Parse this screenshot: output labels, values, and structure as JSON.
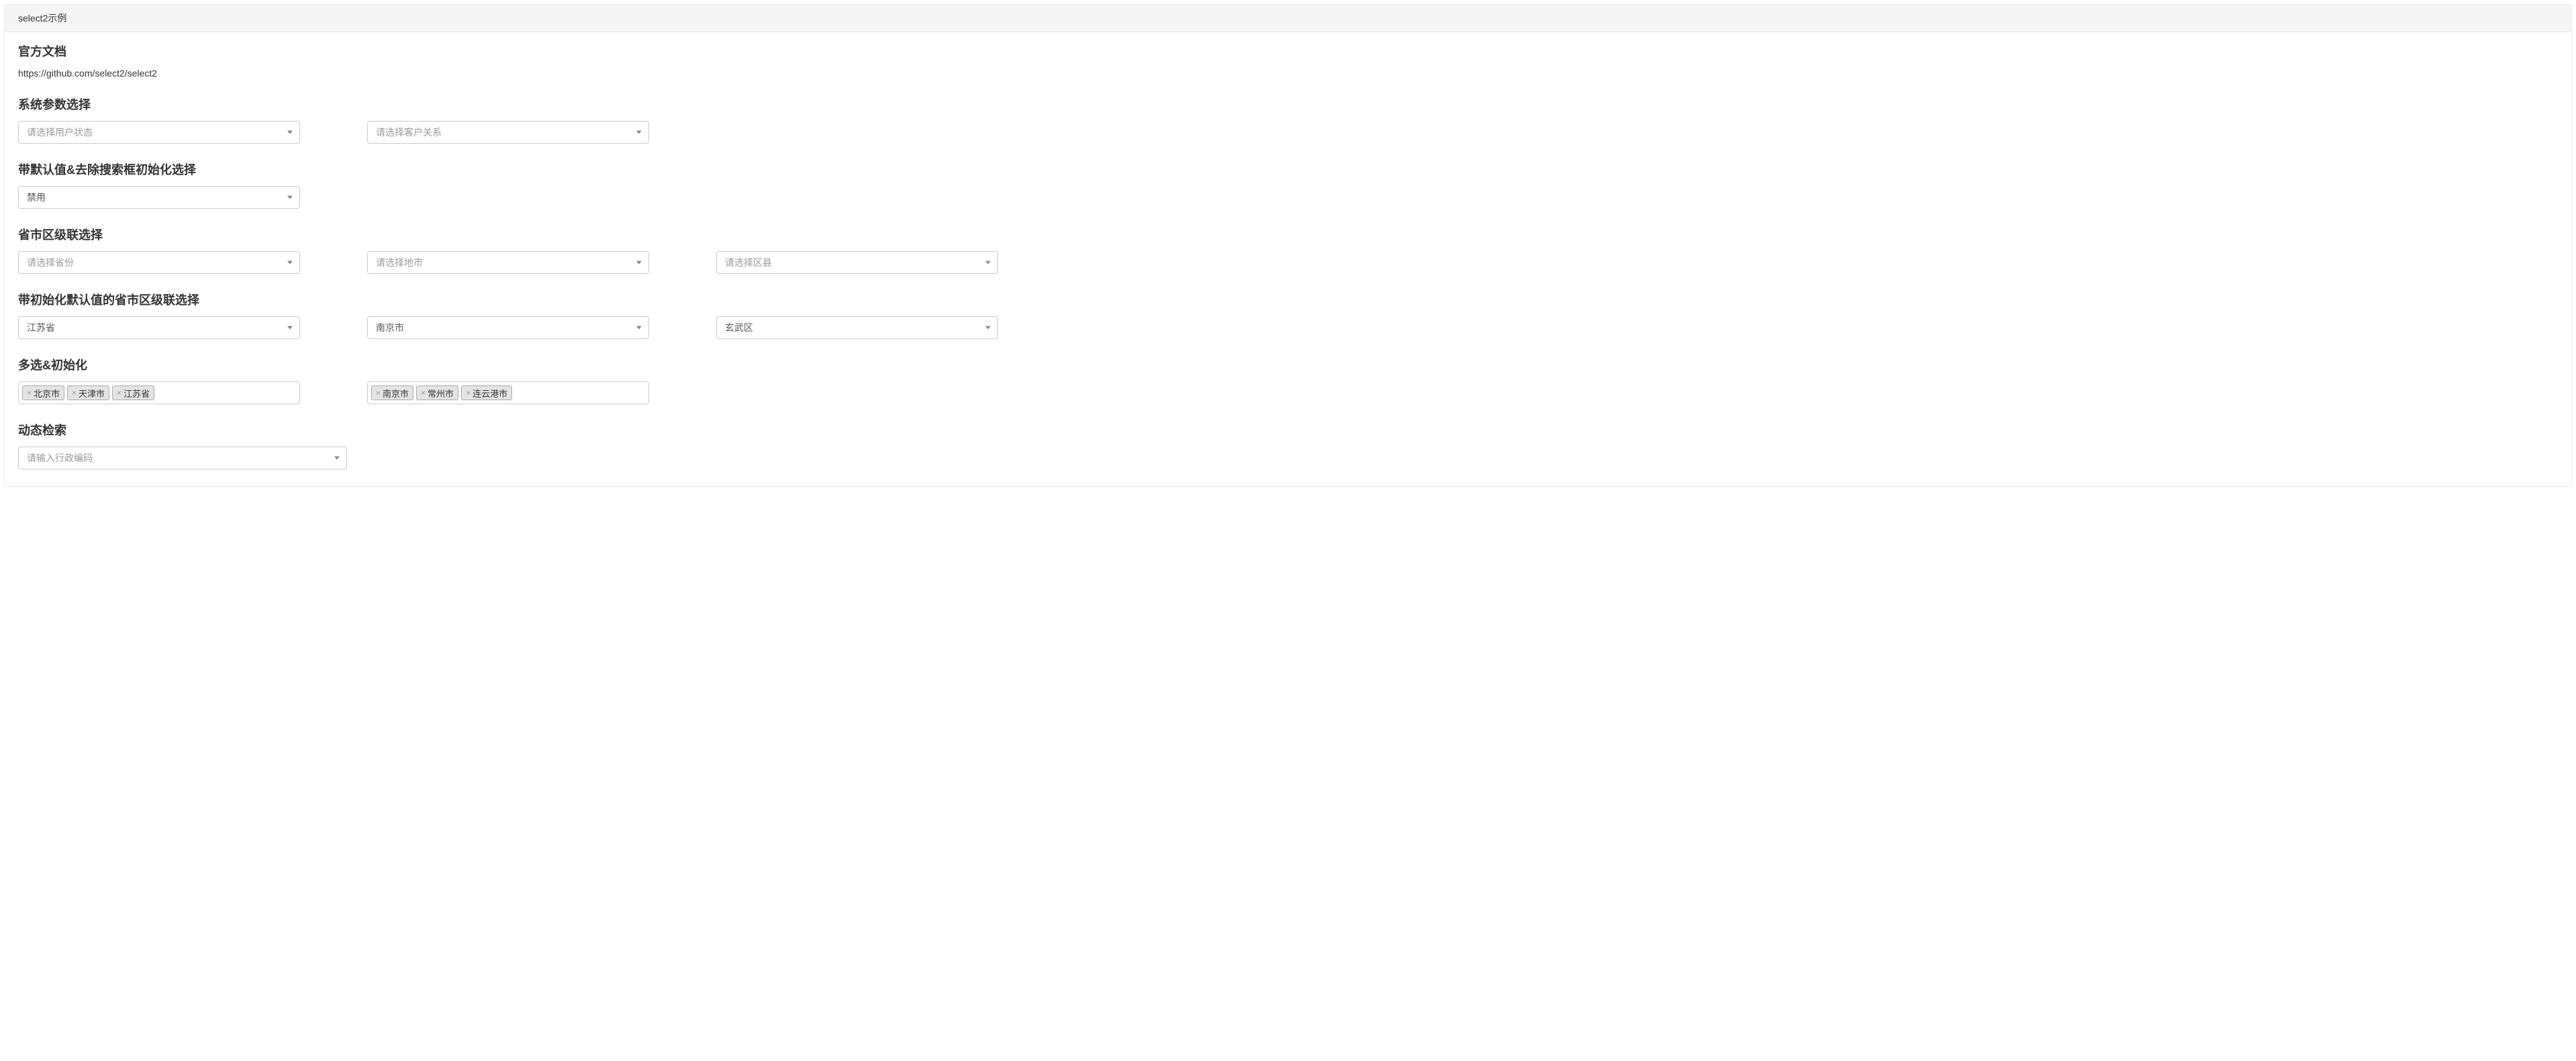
{
  "panel": {
    "title": "select2示例"
  },
  "doc": {
    "heading": "官方文档",
    "url": "https://github.com/select2/select2"
  },
  "sections": {
    "sysParams": {
      "heading": "系统参数选择",
      "select1Placeholder": "请选择用户状态",
      "select2Placeholder": "请选择客户关系"
    },
    "defaultNoSearch": {
      "heading": "带默认值&去除搜索框初始化选择",
      "value": "禁用"
    },
    "cascader": {
      "heading": "省市区级联选择",
      "provincePlaceholder": "请选择省份",
      "cityPlaceholder": "请选择地市",
      "districtPlaceholder": "请选择区县"
    },
    "cascaderDefault": {
      "heading": "带初始化默认值的省市区级联选择",
      "province": "江苏省",
      "city": "南京市",
      "district": "玄武区"
    },
    "multi": {
      "heading": "多选&初始化",
      "set1": [
        "北京市",
        "天津市",
        "江苏省"
      ],
      "set2": [
        "南京市",
        "常州市",
        "连云港市"
      ]
    },
    "dynamic": {
      "heading": "动态检索",
      "placeholder": "请输入行政编码"
    }
  },
  "icons": {
    "remove": "×"
  }
}
